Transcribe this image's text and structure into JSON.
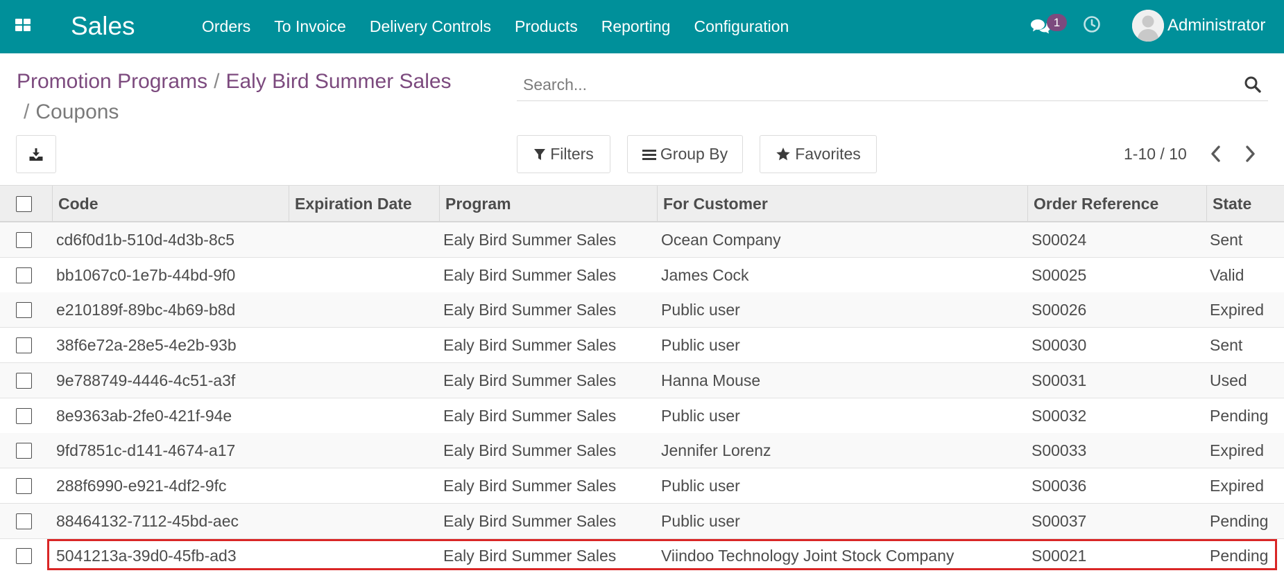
{
  "navbar": {
    "brand": "Sales",
    "menu": [
      "Orders",
      "To Invoice",
      "Delivery Controls",
      "Products",
      "Reporting",
      "Configuration"
    ],
    "chat_badge": "1",
    "user": "Administrator",
    "bg_color": "#00909a"
  },
  "breadcrumb": {
    "items": [
      "Promotion Programs",
      "Ealy Bird Summer Sales"
    ],
    "active": "Coupons",
    "separator": "/"
  },
  "search": {
    "placeholder": "Search..."
  },
  "toolbar": {
    "filters": "Filters",
    "group_by": "Group By",
    "favorites": "Favorites"
  },
  "pager": {
    "text": "1-10 / 10"
  },
  "table": {
    "columns": [
      "Code",
      "Expiration Date",
      "Program",
      "For Customer",
      "Order Reference",
      "State"
    ],
    "rows": [
      {
        "code": "cd6f0d1b-510d-4d3b-8c5",
        "expiration": "",
        "program": "Ealy Bird Summer Sales",
        "customer": "Ocean Company",
        "order_ref": "S00024",
        "state": "Sent"
      },
      {
        "code": "bb1067c0-1e7b-44bd-9f0",
        "expiration": "",
        "program": "Ealy Bird Summer Sales",
        "customer": "James Cock",
        "order_ref": "S00025",
        "state": "Valid"
      },
      {
        "code": "e210189f-89bc-4b69-b8d",
        "expiration": "",
        "program": "Ealy Bird Summer Sales",
        "customer": "Public user",
        "order_ref": "S00026",
        "state": "Expired"
      },
      {
        "code": "38f6e72a-28e5-4e2b-93b",
        "expiration": "",
        "program": "Ealy Bird Summer Sales",
        "customer": "Public user",
        "order_ref": "S00030",
        "state": "Sent"
      },
      {
        "code": "9e788749-4446-4c51-a3f",
        "expiration": "",
        "program": "Ealy Bird Summer Sales",
        "customer": "Hanna Mouse",
        "order_ref": "S00031",
        "state": "Used"
      },
      {
        "code": "8e9363ab-2fe0-421f-94e",
        "expiration": "",
        "program": "Ealy Bird Summer Sales",
        "customer": "Public user",
        "order_ref": "S00032",
        "state": "Pending"
      },
      {
        "code": "9fd7851c-d141-4674-a17",
        "expiration": "",
        "program": "Ealy Bird Summer Sales",
        "customer": "Jennifer Lorenz",
        "order_ref": "S00033",
        "state": "Expired"
      },
      {
        "code": "288f6990-e921-4df2-9fc",
        "expiration": "",
        "program": "Ealy Bird Summer Sales",
        "customer": "Public user",
        "order_ref": "S00036",
        "state": "Expired"
      },
      {
        "code": "88464132-7112-45bd-aec",
        "expiration": "",
        "program": "Ealy Bird Summer Sales",
        "customer": "Public user",
        "order_ref": "S00037",
        "state": "Pending"
      },
      {
        "code": "5041213a-39d0-45fb-ad3",
        "expiration": "",
        "program": "Ealy Bird Summer Sales",
        "customer": "Viindoo Technology Joint Stock Company",
        "order_ref": "S00021",
        "state": "Pending"
      }
    ],
    "highlighted_row": 9,
    "highlight_color": "#d92626"
  }
}
